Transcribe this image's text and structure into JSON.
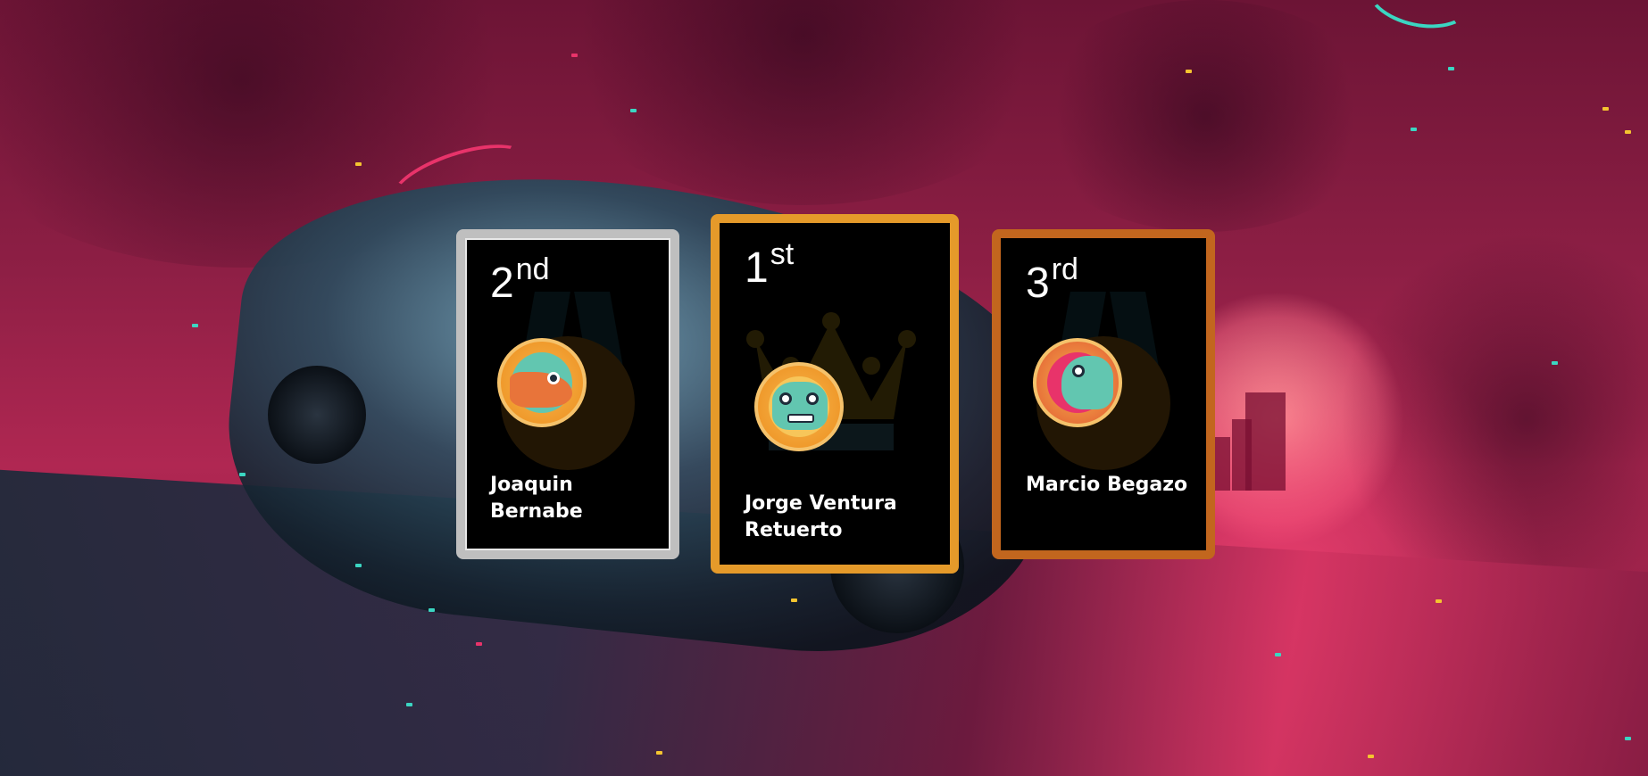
{
  "podium": [
    {
      "position": "second",
      "rank_number": "2",
      "rank_suffix": "nd",
      "name": "Joaquin Bernabe",
      "border_color": "#bfbfbf",
      "avatar_icon": "knight-bird-avatar"
    },
    {
      "position": "first",
      "rank_number": "1",
      "rank_suffix": "st",
      "name": "Jorge Ventura Retuerto",
      "border_color": "#e59a2a",
      "avatar_icon": "crab-robot-avatar"
    },
    {
      "position": "third",
      "rank_number": "3",
      "rank_suffix": "rd",
      "name": "Marcio Begazo",
      "border_color": "#c2661e",
      "avatar_icon": "dinosaur-avatar"
    }
  ],
  "theme": {
    "background": "synthwave-road-sunset",
    "accent_pink": "#e8336a",
    "accent_teal": "#3bd6c2"
  }
}
